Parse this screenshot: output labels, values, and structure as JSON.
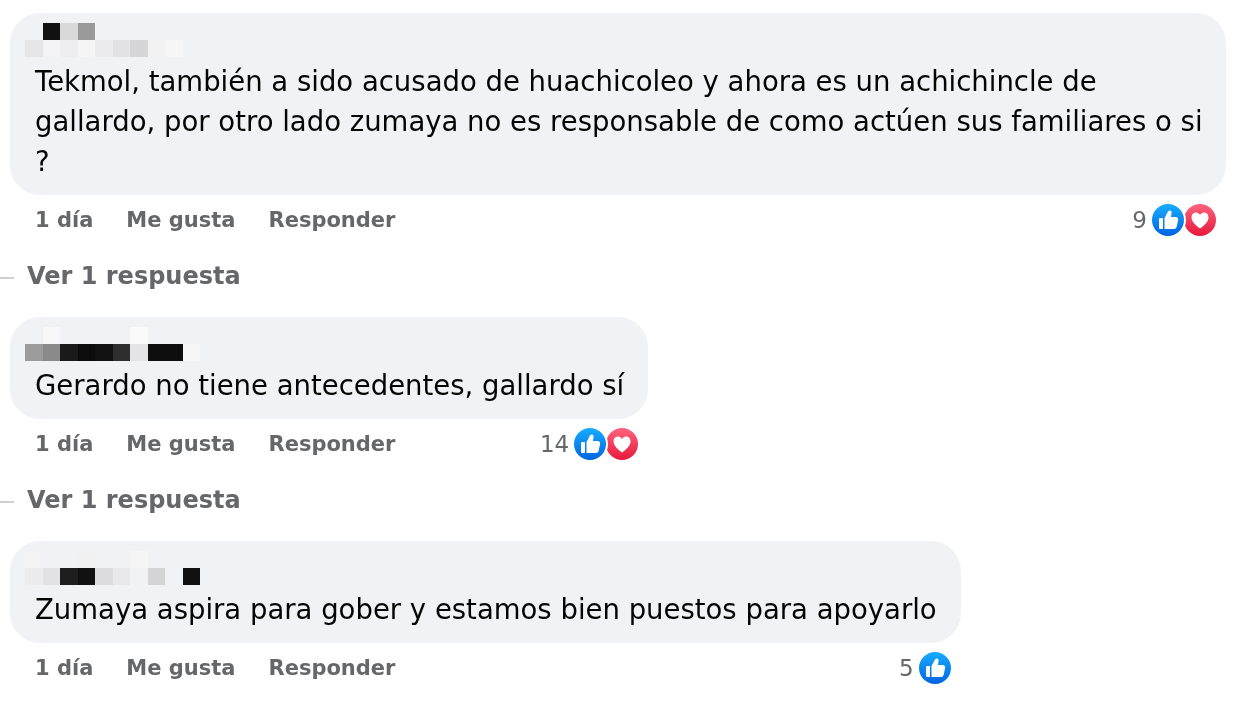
{
  "comments": [
    {
      "text_lines": [
        "Tekmol, también a sido acusado de huachicoleo y ahora es un achichincle de",
        "gallardo, por otro lado zumaya no es responsable de como actúen sus familiares o si",
        "?"
      ],
      "time": "1 día",
      "like_action": "Me gusta",
      "reply_action": "Responder",
      "reaction_count": "9",
      "reactions": [
        {
          "kind": "like"
        },
        {
          "kind": "love"
        }
      ],
      "replies_link": "Ver 1 respuesta"
    },
    {
      "text_lines": [
        "Gerardo no tiene antecedentes, gallardo sí"
      ],
      "time": "1 día",
      "like_action": "Me gusta",
      "reply_action": "Responder",
      "reaction_count": "14",
      "reactions": [
        {
          "kind": "like"
        },
        {
          "kind": "love"
        }
      ],
      "replies_link": "Ver 1 respuesta"
    },
    {
      "text_lines": [
        "Zumaya aspira para gober y estamos bien puestos para apoyarlo"
      ],
      "time": "1 día",
      "like_action": "Me gusta",
      "reply_action": "Responder",
      "reaction_count": "5",
      "reactions": [
        {
          "kind": "like"
        }
      ]
    }
  ]
}
